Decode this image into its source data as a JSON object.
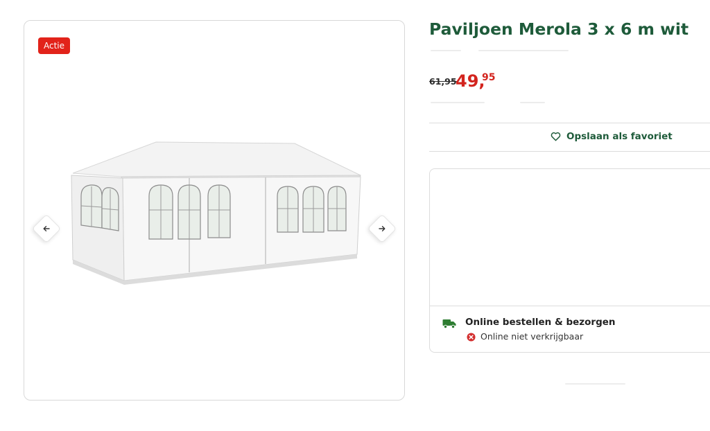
{
  "product": {
    "title": "Paviljoen Merola 3 x 6 m wit",
    "badge": "Actie",
    "image_alt": "paviljoen-image",
    "price_old": "61,95",
    "price_new_int": "49,",
    "price_new_dec": "95"
  },
  "favorite": {
    "label": "Opslaan als favoriet"
  },
  "delivery": {
    "title": "Online bestellen & bezorgen",
    "status": "Online niet verkrijgbaar"
  },
  "colors": {
    "brand_green": "#1e5b3a",
    "sale_red": "#d3241e",
    "badge_red": "#e2231a",
    "truck_green": "#2e7d32",
    "unavailable_red": "#d32f2f"
  },
  "icons": {
    "prev": "arrow-left-icon",
    "next": "arrow-right-icon",
    "favorite": "heart-icon",
    "delivery": "truck-icon",
    "status": "close-circle-icon"
  }
}
